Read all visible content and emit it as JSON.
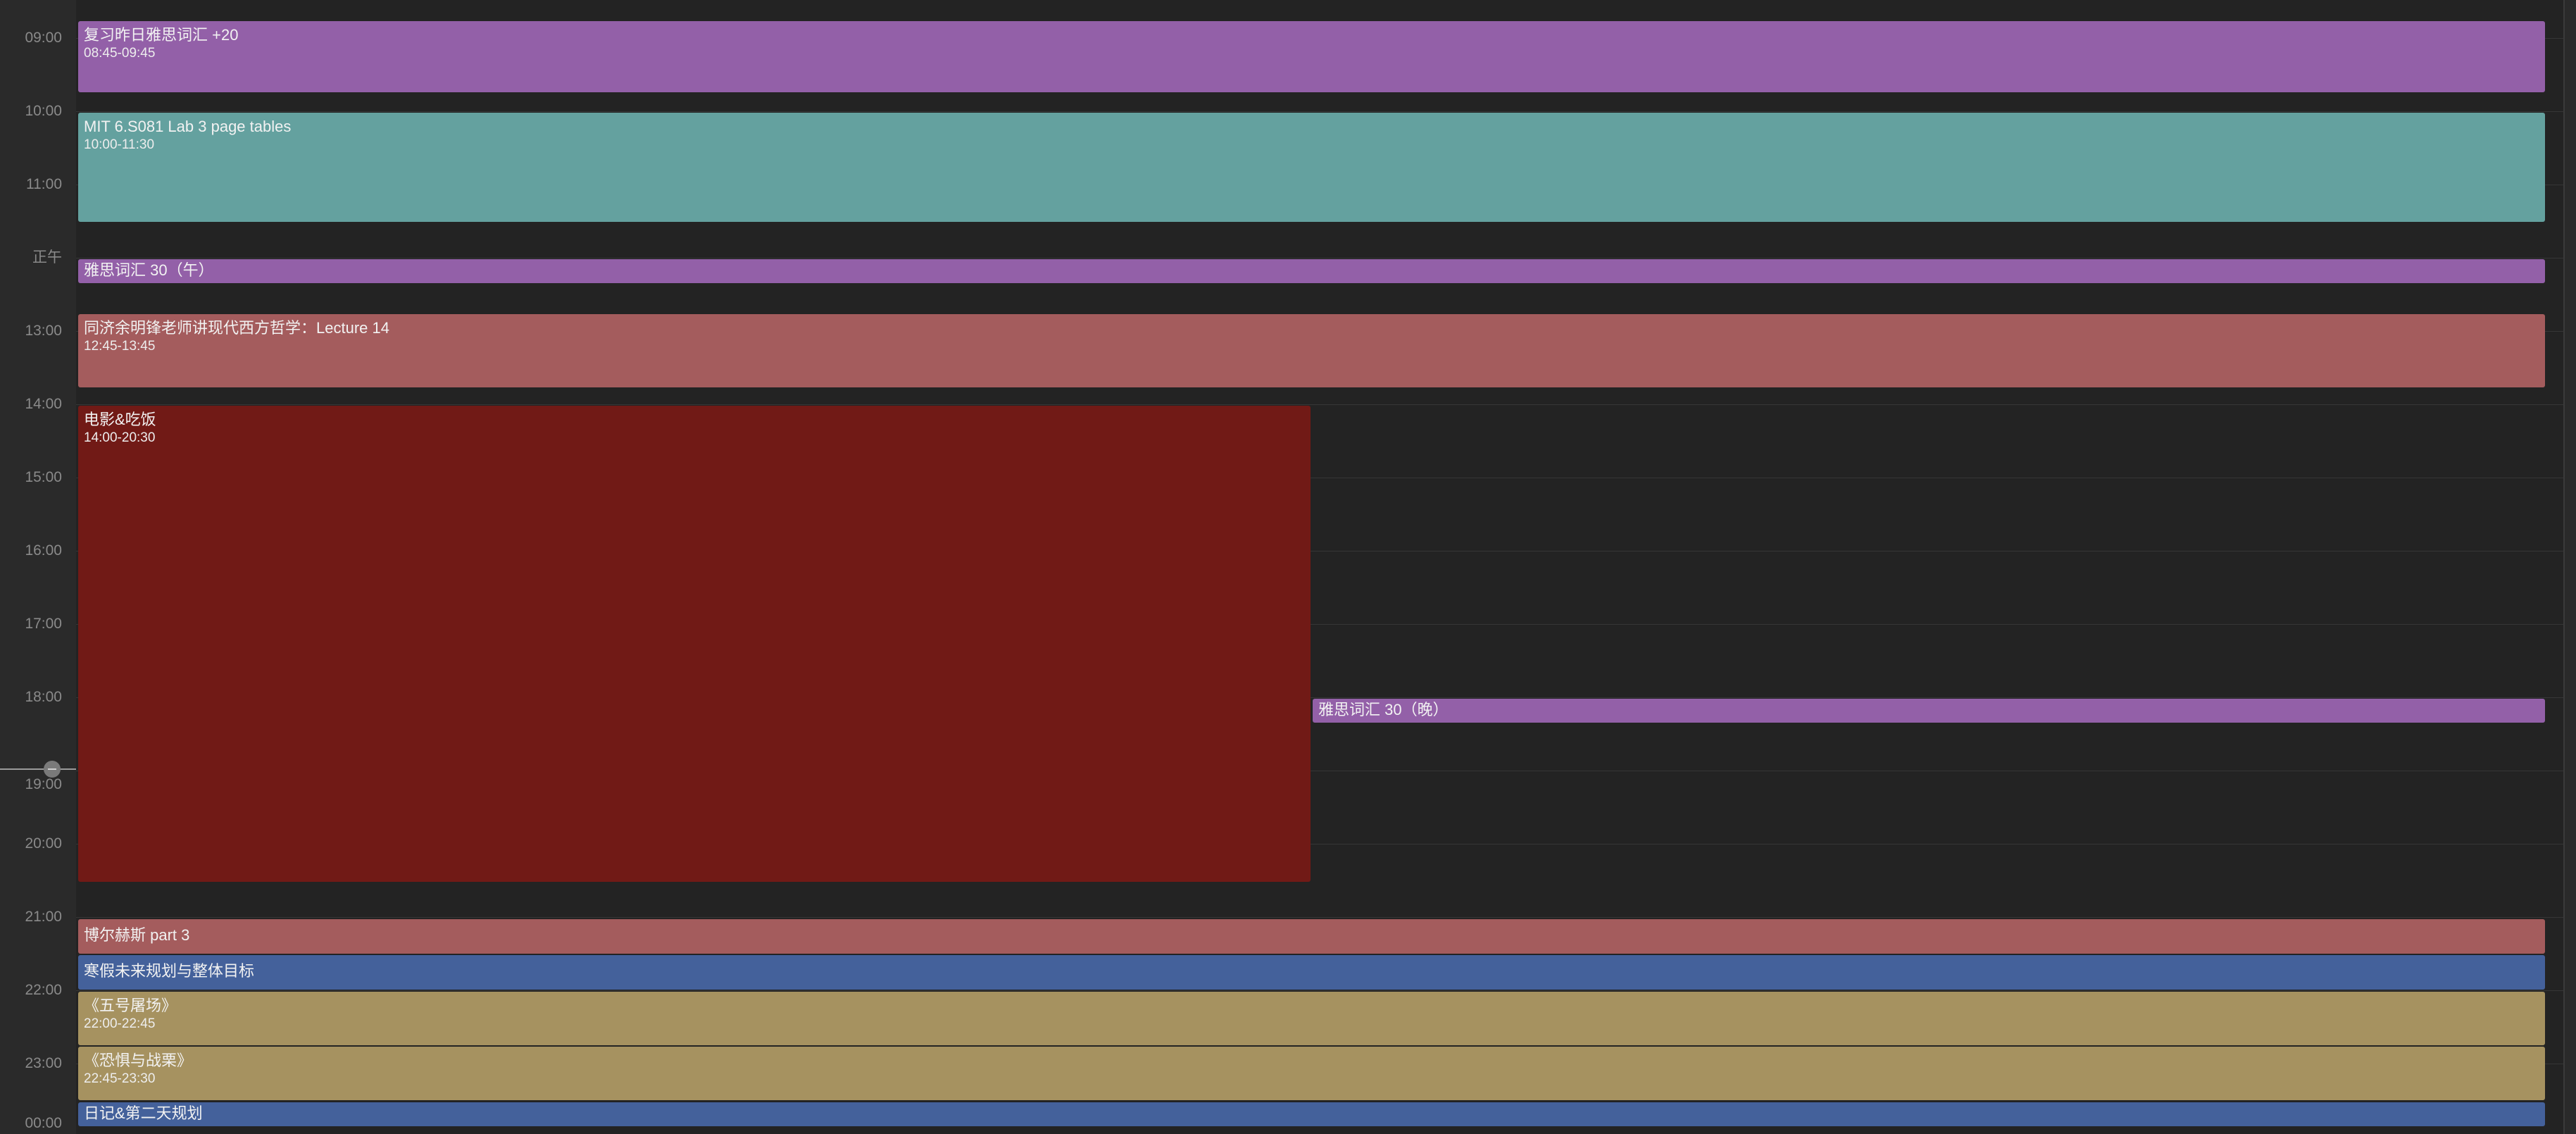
{
  "hours": [
    {
      "label": "09:00"
    },
    {
      "label": "10:00"
    },
    {
      "label": "11:00"
    },
    {
      "label": "正午"
    },
    {
      "label": "13:00"
    },
    {
      "label": "14:00"
    },
    {
      "label": "15:00"
    },
    {
      "label": "16:00"
    },
    {
      "label": "17:00"
    },
    {
      "label": "18:00"
    },
    {
      "label": "19:00"
    },
    {
      "label": "20:00"
    },
    {
      "label": "21:00"
    },
    {
      "label": "22:00"
    },
    {
      "label": "23:00"
    },
    {
      "label": "00:00"
    }
  ],
  "events": [
    {
      "title": "复习昨日雅思词汇 +20",
      "time": "08:45-09:45",
      "color": "#9360a8"
    },
    {
      "title": "MIT 6.S081 Lab 3 page tables",
      "time": "10:00-11:30",
      "color": "#64a19f"
    },
    {
      "title": "雅思词汇 30（午）",
      "color": "#9360a8"
    },
    {
      "title": "同济余明锋老师讲现代西方哲学：Lecture 14",
      "time": "12:45-13:45",
      "color": "#a45c5d"
    },
    {
      "title": "电影&吃饭",
      "time": "14:00-20:30",
      "color": "#711a16"
    },
    {
      "title": "雅思词汇 30（晚）",
      "color": "#9360a8"
    },
    {
      "title": "博尔赫斯 part 3",
      "color": "#a45c5d"
    },
    {
      "title": "寒假未来规划与整体目标",
      "color": "#44619b"
    },
    {
      "title": "《五号屠场》",
      "time": "22:00-22:45",
      "color": "#a69260"
    },
    {
      "title": "《恐惧与战栗》",
      "time": "22:45-23:30",
      "color": "#a69260"
    },
    {
      "title": "日记&第二天规划",
      "color": "#44619b"
    }
  ]
}
